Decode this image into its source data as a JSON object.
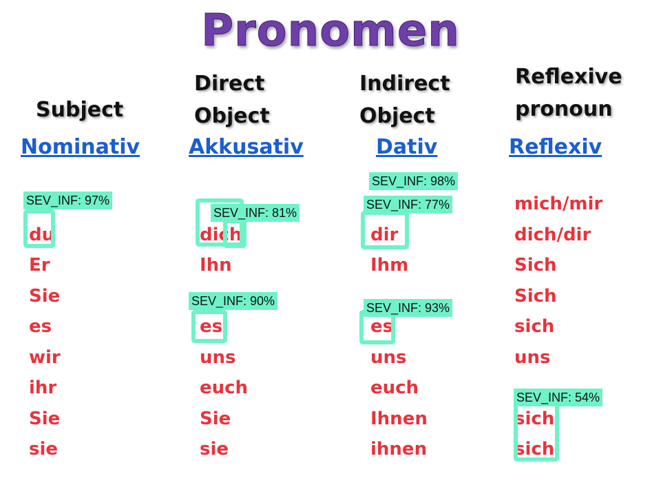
{
  "title": "Pronomen",
  "categories": {
    "subject": "Subject",
    "direct_line1": "Direct",
    "direct_line2": "Object",
    "indirect_line1": "Indirect",
    "indirect_line2": "Object",
    "reflexive_line1": "Reflexive",
    "reflexive_line2": "pronoun"
  },
  "cases": {
    "nominativ": "Nominativ",
    "akkusativ": "Akkusativ",
    "dativ": "Dativ",
    "reflexiv": "Reflexiv"
  },
  "columns": {
    "nominativ": [
      "",
      "du",
      "Er",
      "Sie",
      "es",
      "wir",
      "ihr",
      "Sie",
      "sie"
    ],
    "akkusativ": [
      "",
      "dich",
      "Ihn",
      "",
      "es",
      "uns",
      "euch",
      "Sie",
      "sie"
    ],
    "dativ": [
      "",
      "dir",
      "Ihm",
      "",
      "es",
      "uns",
      "euch",
      "Ihnen",
      "ihnen"
    ],
    "reflexiv": [
      "mich/mir",
      "dich/dir",
      "Sich",
      "Sich",
      "sich",
      "uns",
      "",
      "sich",
      "sich"
    ]
  },
  "detections": {
    "d1": "SEV_INF: 97%",
    "d2": "SEV_INF: 81%",
    "d3": "SEV_INF: 90%",
    "d4": "SEV_INF: 98%",
    "d5": "SEV_INF: 77%",
    "d6": "SEV_INF: 93%",
    "d7": "SEV_INF: 54%"
  },
  "colors": {
    "title": "#6f3fa8",
    "link": "#1a5fd0",
    "pronoun": "#e8333c",
    "detection": "#6ff2c8"
  }
}
